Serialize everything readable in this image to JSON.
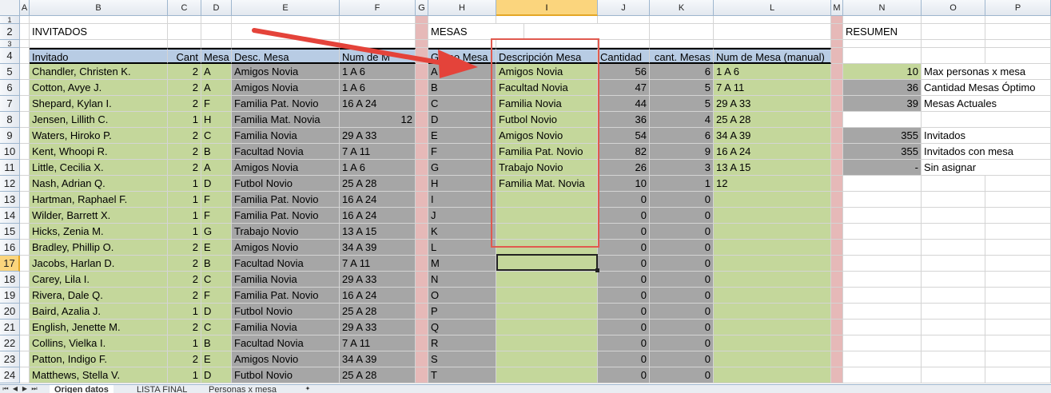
{
  "columns": [
    "A",
    "B",
    "C",
    "D",
    "E",
    "F",
    "G",
    "H",
    "I",
    "J",
    "K",
    "L",
    "M",
    "N",
    "O",
    "P"
  ],
  "selected_column": "I",
  "selected_row": "17",
  "titles": {
    "invitados": "INVITADOS",
    "mesas": "MESAS",
    "resumen": "RESUMEN"
  },
  "headers": {
    "invitado": "Invitado",
    "cant": "Cant",
    "mesa": "Mesa",
    "desc_mesa": "Desc. Mesa",
    "num_de": "Num de M",
    "grupo_mesa": "Grupo Mesa",
    "descripcion_mesa": "Descripción Mesa",
    "cantidad": "Cantidad",
    "cant_mesas": "cant. Mesas",
    "num_mesa_manual": "Num de Mesa (manual)"
  },
  "rows": [
    {
      "row": "5",
      "name": "Chandler, Christen K.",
      "cant": "2",
      "mesa": "A",
      "desc": "Amigos Novia",
      "num": "1 A 6",
      "numr": "",
      "grupo": "A",
      "gdesc": "Amigos Novia",
      "cantidad": "56",
      "cmesas": "6",
      "manual": "1 A 6",
      "n": "10",
      "o": "Max personas x mesa"
    },
    {
      "row": "6",
      "name": "Cotton, Avye J.",
      "cant": "2",
      "mesa": "A",
      "desc": "Amigos Novia",
      "num": "1 A 6",
      "numr": "",
      "grupo": "B",
      "gdesc": "Facultad  Novia",
      "cantidad": "47",
      "cmesas": "5",
      "manual": "7 A 11",
      "n": "36",
      "o": "Cantidad Mesas Óptimo"
    },
    {
      "row": "7",
      "name": "Shepard, Kylan I.",
      "cant": "2",
      "mesa": "F",
      "desc": "Familia Pat. Novio",
      "num": "16 A 24",
      "numr": "",
      "grupo": "C",
      "gdesc": "Familia Novia",
      "cantidad": "44",
      "cmesas": "5",
      "manual": "29 A 33",
      "n": "39",
      "o": "Mesas Actuales"
    },
    {
      "row": "8",
      "name": "Jensen, Lillith C.",
      "cant": "1",
      "mesa": "H",
      "desc": "Familia Mat. Novia",
      "num": "",
      "numr": "12",
      "grupo": "D",
      "gdesc": "Futbol Novio",
      "cantidad": "36",
      "cmesas": "4",
      "manual": "25 A 28",
      "n": "",
      "o": ""
    },
    {
      "row": "9",
      "name": "Waters, Hiroko P.",
      "cant": "2",
      "mesa": "C",
      "desc": "Familia Novia",
      "num": "29 A 33",
      "numr": "",
      "grupo": "E",
      "gdesc": "Amigos Novio",
      "cantidad": "54",
      "cmesas": "6",
      "manual": "34 A 39",
      "n": "355",
      "o": "Invitados"
    },
    {
      "row": "10",
      "name": "Kent, Whoopi R.",
      "cant": "2",
      "mesa": "B",
      "desc": "Facultad  Novia",
      "num": "7 A 11",
      "numr": "",
      "grupo": "F",
      "gdesc": "Familia Pat. Novio",
      "cantidad": "82",
      "cmesas": "9",
      "manual": "16 A 24",
      "n": "355",
      "o": "Invitados con mesa"
    },
    {
      "row": "11",
      "name": "Little, Cecilia X.",
      "cant": "2",
      "mesa": "A",
      "desc": "Amigos Novia",
      "num": "1 A 6",
      "numr": "",
      "grupo": "G",
      "gdesc": "Trabajo Novio",
      "cantidad": "26",
      "cmesas": "3",
      "manual": "13 A 15",
      "n": "-",
      "o": "Sin asignar"
    },
    {
      "row": "12",
      "name": "Nash, Adrian Q.",
      "cant": "1",
      "mesa": "D",
      "desc": "Futbol Novio",
      "num": "25 A 28",
      "numr": "",
      "grupo": "H",
      "gdesc": "Familia Mat. Novia",
      "cantidad": "10",
      "cmesas": "1",
      "manual": "12",
      "n": "",
      "o": ""
    },
    {
      "row": "13",
      "name": "Hartman, Raphael F.",
      "cant": "1",
      "mesa": "F",
      "desc": "Familia Pat. Novio",
      "num": "16 A 24",
      "numr": "",
      "grupo": "I",
      "gdesc": "",
      "cantidad": "0",
      "cmesas": "0",
      "manual": "",
      "n": "",
      "o": ""
    },
    {
      "row": "14",
      "name": "Wilder, Barrett X.",
      "cant": "1",
      "mesa": "F",
      "desc": "Familia Pat. Novio",
      "num": "16 A 24",
      "numr": "",
      "grupo": "J",
      "gdesc": "",
      "cantidad": "0",
      "cmesas": "0",
      "manual": "",
      "n": "",
      "o": ""
    },
    {
      "row": "15",
      "name": "Hicks, Zenia M.",
      "cant": "1",
      "mesa": "G",
      "desc": "Trabajo Novio",
      "num": "13 A 15",
      "numr": "",
      "grupo": "K",
      "gdesc": "",
      "cantidad": "0",
      "cmesas": "0",
      "manual": "",
      "n": "",
      "o": ""
    },
    {
      "row": "16",
      "name": "Bradley, Phillip O.",
      "cant": "2",
      "mesa": "E",
      "desc": "Amigos Novio",
      "num": "34 A 39",
      "numr": "",
      "grupo": "L",
      "gdesc": "",
      "cantidad": "0",
      "cmesas": "0",
      "manual": "",
      "n": "",
      "o": ""
    },
    {
      "row": "17",
      "name": "Jacobs, Harlan D.",
      "cant": "2",
      "mesa": "B",
      "desc": "Facultad  Novia",
      "num": "7 A 11",
      "numr": "",
      "grupo": "M",
      "gdesc": "",
      "cantidad": "0",
      "cmesas": "0",
      "manual": "",
      "n": "",
      "o": ""
    },
    {
      "row": "18",
      "name": "Carey, Lila I.",
      "cant": "2",
      "mesa": "C",
      "desc": "Familia Novia",
      "num": "29 A 33",
      "numr": "",
      "grupo": "N",
      "gdesc": "",
      "cantidad": "0",
      "cmesas": "0",
      "manual": "",
      "n": "",
      "o": ""
    },
    {
      "row": "19",
      "name": "Rivera, Dale Q.",
      "cant": "2",
      "mesa": "F",
      "desc": "Familia Pat. Novio",
      "num": "16 A 24",
      "numr": "",
      "grupo": "O",
      "gdesc": "",
      "cantidad": "0",
      "cmesas": "0",
      "manual": "",
      "n": "",
      "o": ""
    },
    {
      "row": "20",
      "name": "Baird, Azalia J.",
      "cant": "1",
      "mesa": "D",
      "desc": "Futbol Novio",
      "num": "25 A 28",
      "numr": "",
      "grupo": "P",
      "gdesc": "",
      "cantidad": "0",
      "cmesas": "0",
      "manual": "",
      "n": "",
      "o": ""
    },
    {
      "row": "21",
      "name": "English, Jenette M.",
      "cant": "2",
      "mesa": "C",
      "desc": "Familia Novia",
      "num": "29 A 33",
      "numr": "",
      "grupo": "Q",
      "gdesc": "",
      "cantidad": "0",
      "cmesas": "0",
      "manual": "",
      "n": "",
      "o": ""
    },
    {
      "row": "22",
      "name": "Collins, Vielka I.",
      "cant": "1",
      "mesa": "B",
      "desc": "Facultad  Novia",
      "num": "7 A 11",
      "numr": "",
      "grupo": "R",
      "gdesc": "",
      "cantidad": "0",
      "cmesas": "0",
      "manual": "",
      "n": "",
      "o": ""
    },
    {
      "row": "23",
      "name": "Patton, Indigo F.",
      "cant": "2",
      "mesa": "E",
      "desc": "Amigos Novio",
      "num": "34 A 39",
      "numr": "",
      "grupo": "S",
      "gdesc": "",
      "cantidad": "0",
      "cmesas": "0",
      "manual": "",
      "n": "",
      "o": ""
    },
    {
      "row": "24",
      "name": "Matthews, Stella V.",
      "cant": "1",
      "mesa": "D",
      "desc": "Futbol Novio",
      "num": "25 A 28",
      "numr": "",
      "grupo": "T",
      "gdesc": "",
      "cantidad": "0",
      "cmesas": "0",
      "manual": "",
      "n": "",
      "o": ""
    }
  ],
  "sheet_tabs": [
    "Origen datos",
    "LISTA FINAL",
    "Personas x mesa"
  ],
  "colors": {
    "green": "#c4d79b",
    "gray": "#a6a6a6",
    "pink": "#e6b9b8",
    "header_blue": "#b8cce4",
    "highlight": "#e05a4f"
  }
}
